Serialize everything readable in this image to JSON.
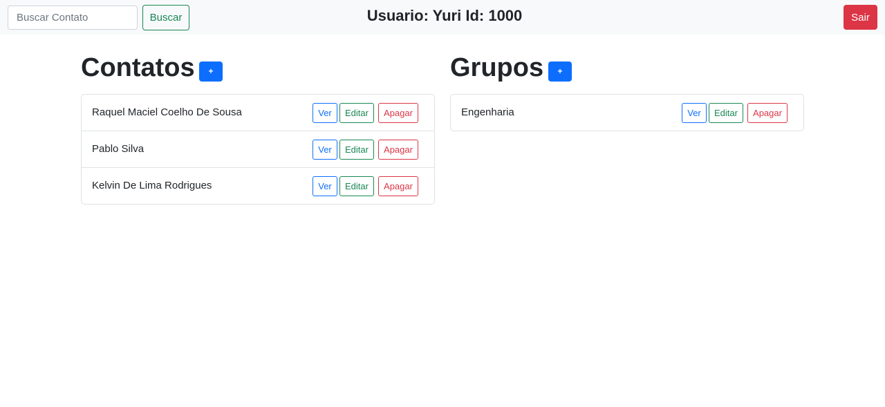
{
  "header": {
    "search_placeholder": "Buscar Contato",
    "search_value": "",
    "search_button": "Buscar",
    "user_label": "Usuario: Yuri Id: 1000",
    "logout_button": "Sair"
  },
  "contacts": {
    "title": "Contatos",
    "add_label": "+",
    "items": [
      {
        "name": "Raquel Maciel Coelho De Sousa",
        "view": "Ver",
        "edit": "Editar",
        "delete": "Apagar"
      },
      {
        "name": "Pablo Silva",
        "view": "Ver",
        "edit": "Editar",
        "delete": "Apagar"
      },
      {
        "name": "Kelvin De Lima Rodrigues",
        "view": "Ver",
        "edit": "Editar",
        "delete": "Apagar"
      }
    ]
  },
  "groups": {
    "title": "Grupos",
    "add_label": "+",
    "items": [
      {
        "name": "Engenharia",
        "view": "Ver",
        "edit": "Editar",
        "delete": "Apagar"
      }
    ]
  },
  "colors": {
    "primary": "#0d6efd",
    "success": "#198754",
    "danger": "#dc3545",
    "navbar_bg": "#f8f9fa"
  }
}
